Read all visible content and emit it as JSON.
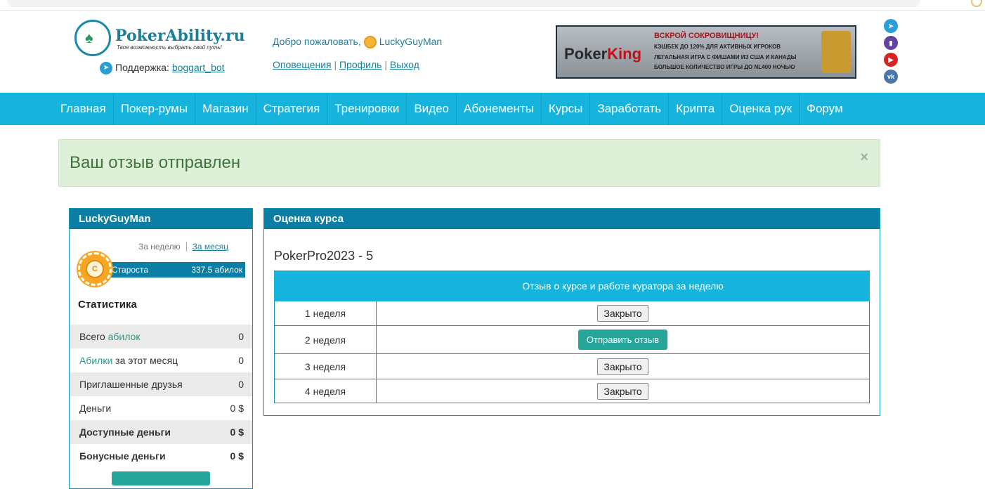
{
  "header": {
    "logo_title": "PokerAbility.ru",
    "logo_tagline": "Твоя возможность выбрать свой путь!",
    "support_label": "Поддержка:",
    "support_link": "boggart_bot",
    "welcome_text": "Добро пожаловать,",
    "username": "LuckyGuyMan",
    "links": [
      "Оповещения",
      "Профиль",
      "Выход"
    ],
    "banner": {
      "brand": "PokerKing",
      "headline": "ВСКРОЙ СОКРОВИЩНИЦУ!",
      "lines": [
        "КЭШБЕК ДО 120% ДЛЯ АКТИВНЫХ ИГРОКОВ",
        "ЛЕГАЛЬНАЯ ИГРА С ФИШАМИ ИЗ США И КАНАДЫ",
        "БОЛЬШОЕ КОЛИЧЕСТВО ИГРЫ ДО NL400 НОЧЬЮ"
      ]
    },
    "social_icons": [
      "telegram-icon",
      "twitch-icon",
      "youtube-icon",
      "vk-icon"
    ]
  },
  "nav": [
    "Главная",
    "Покер-румы",
    "Магазин",
    "Стратегия",
    "Тренировки",
    "Видео",
    "Абонементы",
    "Курсы",
    "Заработать",
    "Крипта",
    "Оценка рук",
    "Форум"
  ],
  "alert": {
    "message": "Ваш отзыв отправлен",
    "close": "×"
  },
  "sidebar": {
    "title": "LuckyGuyMan",
    "tab_week": "За неделю",
    "tab_month": "За месяц",
    "rank_letter": "C",
    "rank_name": "Староста",
    "rank_value": "337.5 абилок",
    "stats_title": "Статистика",
    "stats": [
      {
        "label_pre": "Всего ",
        "label_hl": "абилок",
        "label_post": "",
        "value": "0"
      },
      {
        "label_pre": "",
        "label_hl": "Абилки",
        "label_post": " за этот месяц",
        "value": "0"
      },
      {
        "label_pre": "Приглашенные друзья",
        "label_hl": "",
        "label_post": "",
        "value": "0"
      },
      {
        "label_pre": "Деньги",
        "label_hl": "",
        "label_post": "",
        "value": "0 $"
      },
      {
        "label_pre": "Доступные деньги",
        "label_hl": "",
        "label_post": "",
        "value": "0 $"
      },
      {
        "label_pre": "Бонусные деньги",
        "label_hl": "",
        "label_post": "",
        "value": "0 $"
      }
    ]
  },
  "main": {
    "title": "Оценка курса",
    "course": "PokerPro2023 - 5",
    "table_header": [
      "",
      "Отзыв о курсе и работе куратора за неделю"
    ],
    "rows": [
      {
        "week": "1 неделя",
        "action": "Закрыто"
      },
      {
        "week": "2 неделя",
        "action": "Отправить отзыв"
      },
      {
        "week": "3 неделя",
        "action": "Закрыто"
      },
      {
        "week": "4 неделя",
        "action": "Закрыто"
      }
    ]
  }
}
